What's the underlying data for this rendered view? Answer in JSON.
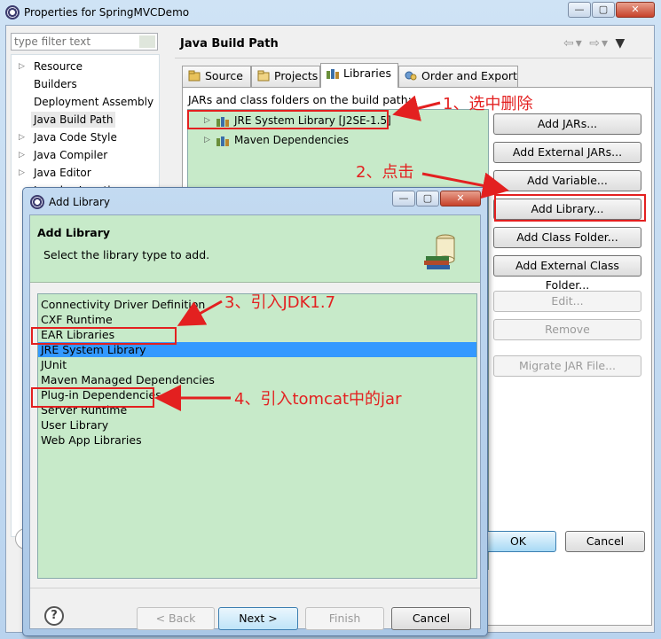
{
  "window": {
    "title": "Properties for SpringMVCDemo",
    "min": "—",
    "max": "▢",
    "close": "✕"
  },
  "filter": {
    "placeholder": "type filter text"
  },
  "nav": {
    "items": [
      {
        "label": "Resource",
        "expandable": true
      },
      {
        "label": "Builders",
        "expandable": false
      },
      {
        "label": "Deployment Assembly",
        "expandable": false
      },
      {
        "label": "Java Build Path",
        "expandable": false,
        "selected": true
      },
      {
        "label": "Java Code Style",
        "expandable": true
      },
      {
        "label": "Java Compiler",
        "expandable": true
      },
      {
        "label": "Java Editor",
        "expandable": true
      },
      {
        "label": "Javadoc Location",
        "expandable": false
      }
    ]
  },
  "page": {
    "title": "Java Build Path"
  },
  "tabs": [
    {
      "label": "Source",
      "icon": "source-folder-icon"
    },
    {
      "label": "Projects",
      "icon": "projects-folder-icon"
    },
    {
      "label": "Libraries",
      "icon": "libraries-icon",
      "active": true
    },
    {
      "label": "Order and Export",
      "icon": "order-export-icon"
    }
  ],
  "libraries": {
    "label": "JARs and class folders on the build path:",
    "entries": [
      {
        "label": "JRE System Library [J2SE-1.5]"
      },
      {
        "label": "Maven Dependencies"
      }
    ]
  },
  "side_buttons": [
    {
      "label": "Add JARs...",
      "enabled": true
    },
    {
      "label": "Add External JARs...",
      "enabled": true
    },
    {
      "label": "Add Variable...",
      "enabled": true
    },
    {
      "label": "Add Library...",
      "enabled": true
    },
    {
      "label": "Add Class Folder...",
      "enabled": true
    },
    {
      "label": "Add External Class Folder...",
      "enabled": true
    },
    {
      "label": "Edit...",
      "enabled": false
    },
    {
      "label": "Remove",
      "enabled": false
    },
    {
      "label": "Migrate JAR File...",
      "enabled": false
    }
  ],
  "main_footer": {
    "ok": "OK",
    "cancel": "Cancel"
  },
  "dialog": {
    "title": "Add Library",
    "header_title": "Add Library",
    "header_desc": "Select the library type to add.",
    "types": [
      "Connectivity Driver Definition",
      "CXF Runtime",
      "EAR Libraries",
      "JRE System Library",
      "JUnit",
      "Maven Managed Dependencies",
      "Plug-in Dependencies",
      "Server Runtime",
      "User Library",
      "Web App Libraries"
    ],
    "selected_type": "JRE System Library",
    "help": "?",
    "back": "< Back",
    "next": "Next >",
    "finish": "Finish",
    "cancel": "Cancel"
  },
  "annotations": {
    "step1": "1、选中删除",
    "step2": "2、点击",
    "step3": "3、引入JDK1.7",
    "step4": "4、引入tomcat中的jar",
    "color": "#e32020"
  },
  "colors": {
    "list_bg": "#c7eac9",
    "selection": "#3399ff",
    "titlebar": "#b9d3ee"
  }
}
